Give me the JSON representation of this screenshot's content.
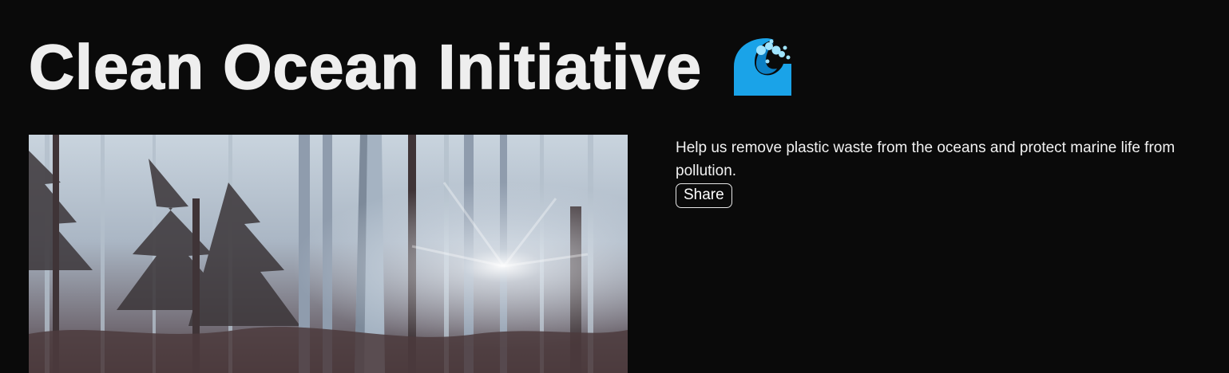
{
  "header": {
    "title": "Clean Ocean Initiative",
    "icon": "water-wave-icon",
    "icon_colors": {
      "primary": "#1aa3e8",
      "foam": "#8fe0ff"
    }
  },
  "hero": {
    "image_description": "",
    "image_colors": {
      "sky": "#c3ced9",
      "trunk_light": "#9aa8b8",
      "trunk_dark": "#3e3236",
      "ground": "#4a3a3c"
    }
  },
  "content": {
    "description": "Help us remove plastic waste from the oceans and protect marine life from pollution.",
    "share_label": "Share"
  },
  "theme": {
    "background": "#0a0a0a",
    "text": "#f0f0f0"
  }
}
